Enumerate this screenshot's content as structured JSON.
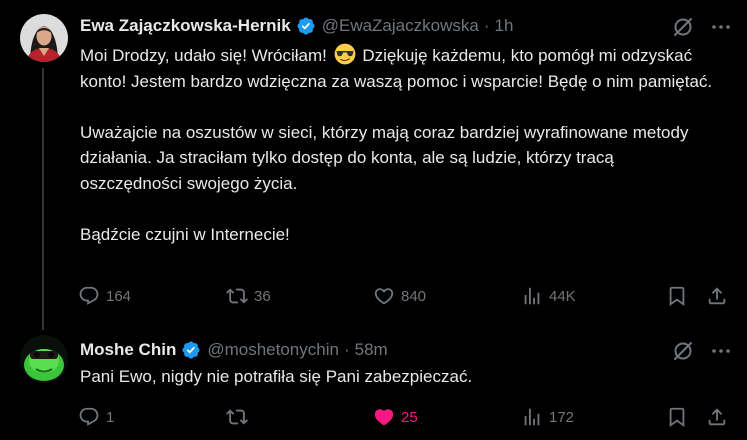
{
  "tweets": [
    {
      "author": {
        "name": "Ewa Zajączkowska-Hernik",
        "handle": "@EwaZajaczkowska",
        "verified": true
      },
      "separator": "·",
      "time": "1h",
      "paragraphs": [
        {
          "before_emoji": "Moi Drodzy, udało się! Wróciłam! ",
          "emoji": "sunglasses-face-emoji",
          "after_emoji": " Dziękuję każdemu, kto pomógł mi odzyskać konto! Jestem bardzo wdzięczna za waszą pomoc i wsparcie! Będę o nim pamiętać."
        },
        {
          "text": "Uważajcie na oszustów w sieci, którzy mają coraz bardziej wyrafinowane metody działania. Ja straciłam tylko dostęp do konta, ale są ludzie, którzy tracą oszczędności swojego życia."
        },
        {
          "text": "Bądźcie czujni w Internecie!"
        }
      ],
      "stats": {
        "replies": "164",
        "reposts": "36",
        "likes": "840",
        "views": "44K"
      },
      "liked": false
    },
    {
      "author": {
        "name": "Moshe Chin",
        "handle": "@moshetonychin",
        "verified": true
      },
      "separator": "·",
      "time": "58m",
      "text": "Pani Ewo, nigdy nie potrafiła się Pani zabezpieczać.",
      "stats": {
        "replies": "1",
        "reposts": "",
        "likes": "25",
        "views": "172"
      },
      "liked": true
    }
  ],
  "icons": {
    "header": [
      "grok-icon",
      "more-icon"
    ],
    "actions": [
      "reply-icon",
      "repost-icon",
      "like-icon",
      "views-icon",
      "bookmark-icon",
      "share-icon"
    ]
  },
  "colors": {
    "background": "#000000",
    "text": "#e7e9ea",
    "secondary": "#71767b",
    "verified": "#1d9bf0",
    "like_active": "#f91880",
    "thread_line": "#333639"
  }
}
